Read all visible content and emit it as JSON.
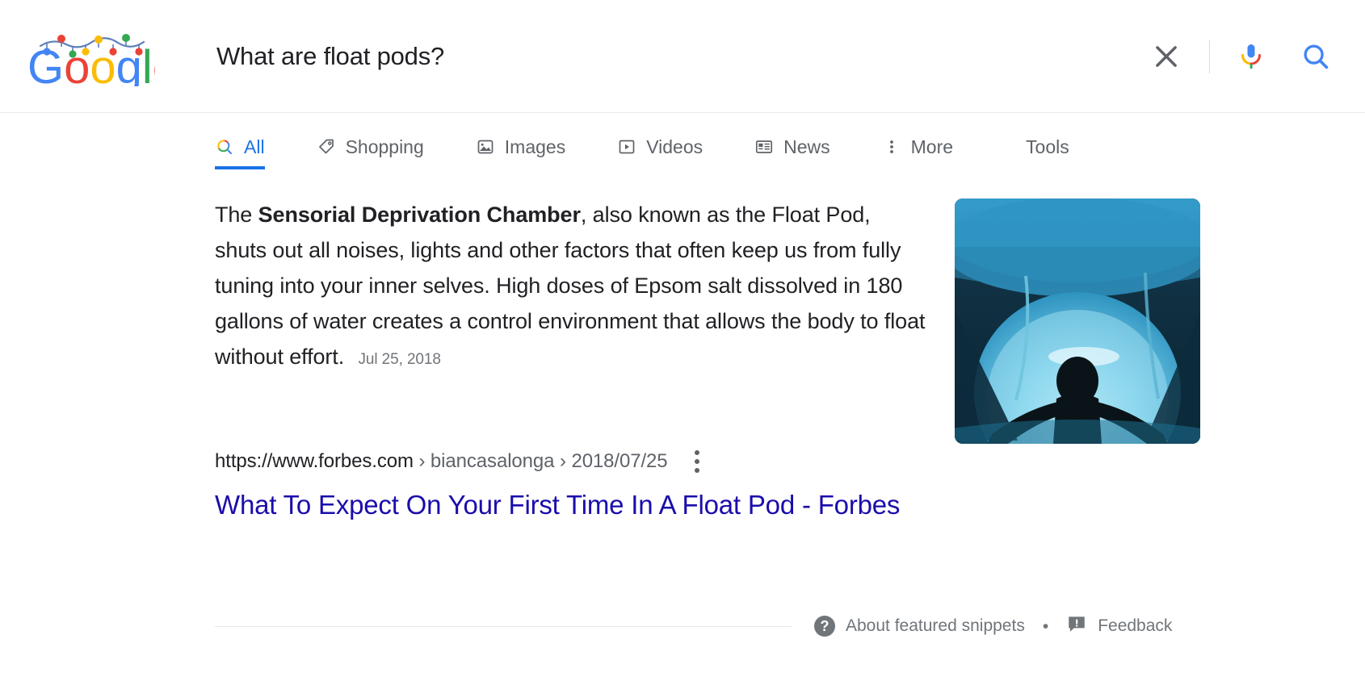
{
  "header": {
    "logo_alt": "Google holiday doodle logo",
    "query_value": "What are float pods?",
    "query_placeholder": "Search",
    "clear_icon": "close-icon",
    "mic_icon": "microphone-icon",
    "search_icon": "search-icon"
  },
  "nav": {
    "tabs": [
      {
        "label": "All",
        "icon": "google-search-icon",
        "active": true
      },
      {
        "label": "Shopping",
        "icon": "price-tag-icon",
        "active": false
      },
      {
        "label": "Images",
        "icon": "image-icon",
        "active": false
      },
      {
        "label": "Videos",
        "icon": "video-play-icon",
        "active": false
      },
      {
        "label": "News",
        "icon": "newspaper-icon",
        "active": false
      },
      {
        "label": "More",
        "icon": "more-vertical-icon",
        "active": false
      },
      {
        "label": "Tools",
        "icon": "",
        "active": false
      }
    ]
  },
  "featured_snippet": {
    "text_before_bold": "The ",
    "bold_phrase": "Sensorial Deprivation Chamber",
    "text_after_bold": ", also known as the Float Pod, shuts out all noises, lights and other factors that often keep us from fully tuning into your inner selves. High doses of Epsom salt dissolved in 180 gallons of water creates a control environment that allows the body to float without effort. ",
    "date": "Jul 25, 2018",
    "thumbnail_alt": "person floating inside an illuminated blue float pod"
  },
  "result": {
    "url_domain": "https://www.forbes.com",
    "url_path": " › biancasalonga › 2018/07/25",
    "menu_icon": "more-vertical-icon",
    "title": "What To Expect On Your First Time In A Float Pod - Forbes"
  },
  "footer": {
    "about_icon": "help-icon",
    "about_label": "About featured snippets",
    "separator": "•",
    "feedback_icon": "feedback-icon",
    "feedback_label": "Feedback"
  },
  "colors": {
    "google_blue": "#4285f4",
    "google_red": "#ea4335",
    "google_yellow": "#fbbc05",
    "google_green": "#34a853",
    "link_blue": "#1a0dab",
    "active_tab_blue": "#1a73e8",
    "text_gray": "#5f6368"
  }
}
